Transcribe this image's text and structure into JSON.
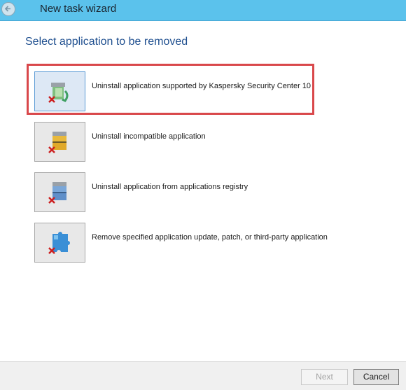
{
  "window": {
    "title": "New task wizard"
  },
  "page": {
    "heading": "Select application to be removed"
  },
  "options": [
    {
      "label": "Uninstall application supported by Kaspersky Security Center 10",
      "icon": "kaspersky-app-remove-icon",
      "selected": true
    },
    {
      "label": "Uninstall incompatible application",
      "icon": "incompatible-app-remove-icon",
      "selected": false
    },
    {
      "label": "Uninstall application from applications registry",
      "icon": "registry-app-remove-icon",
      "selected": false
    },
    {
      "label": "Remove specified application update, patch, or third-party application",
      "icon": "update-patch-remove-icon",
      "selected": false
    }
  ],
  "footer": {
    "next_label": "Next",
    "cancel_label": "Cancel"
  },
  "colors": {
    "titlebar": "#5bc2ec",
    "heading": "#1f4f8f",
    "highlight": "#d9484b"
  }
}
